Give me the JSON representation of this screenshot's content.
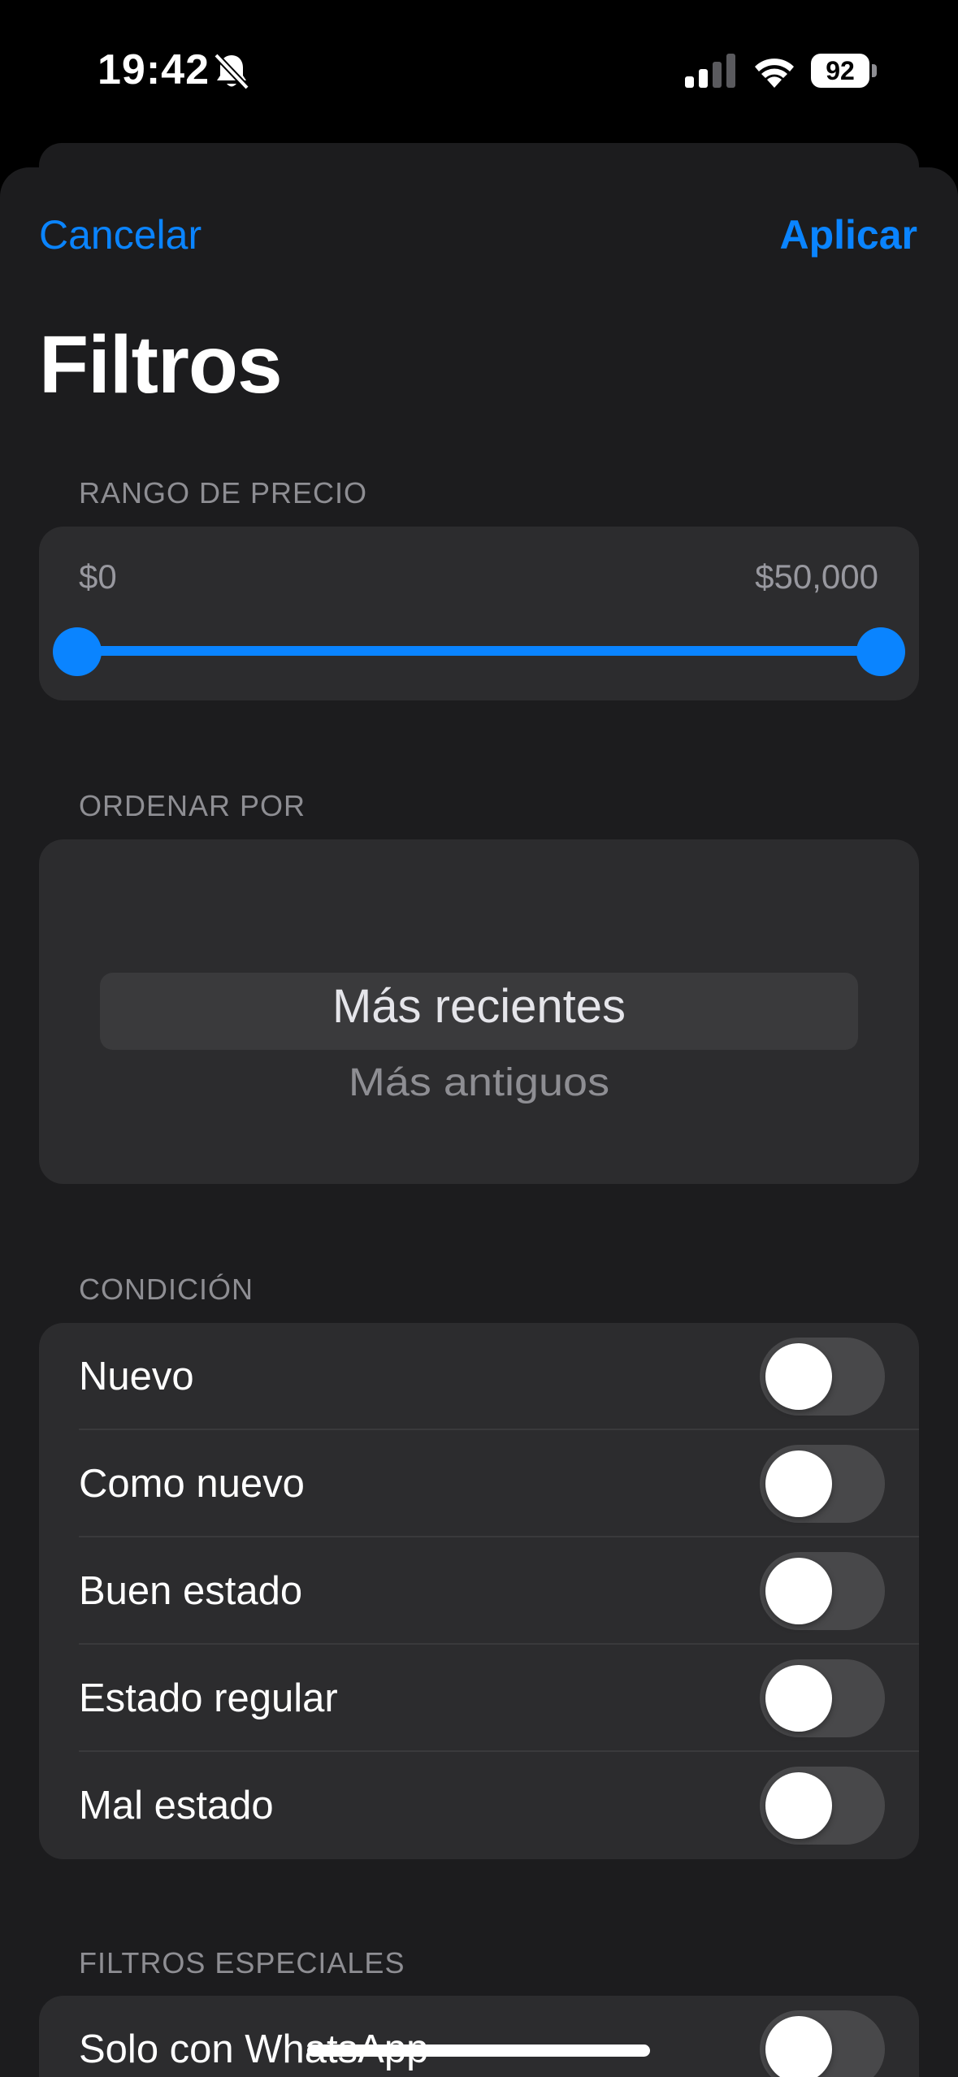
{
  "status_bar": {
    "time": "19:42",
    "battery": "92",
    "icons": [
      "bell-slash-icon",
      "cellular-signal-icon",
      "wifi-icon",
      "battery-icon"
    ]
  },
  "nav": {
    "cancel_label": "Cancelar",
    "apply_label": "Aplicar",
    "accent_color": "#0a84ff"
  },
  "title": "Filtros",
  "price_range": {
    "header": "RANGO DE PRECIO",
    "min_label": "$0",
    "max_label": "$50,000",
    "selected_min_fraction": 0,
    "selected_max_fraction": 1
  },
  "sort": {
    "header": "ORDENAR POR",
    "selected": "Más recientes",
    "next_option": "Más antiguos"
  },
  "condition": {
    "header": "CONDICIÓN",
    "items": [
      {
        "label": "Nuevo",
        "on": false
      },
      {
        "label": "Como nuevo",
        "on": false
      },
      {
        "label": "Buen estado",
        "on": false
      },
      {
        "label": "Estado regular",
        "on": false
      },
      {
        "label": "Mal estado",
        "on": false
      }
    ]
  },
  "special": {
    "header": "FILTROS ESPECIALES",
    "items": [
      {
        "label": "Solo con WhatsApp",
        "on": false
      }
    ]
  }
}
